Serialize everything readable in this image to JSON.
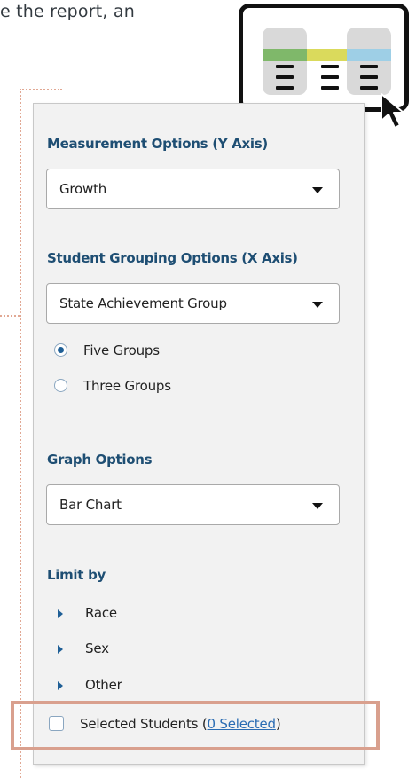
{
  "intro_fragment": "e the report, an",
  "panel": {
    "measurement": {
      "title": "Measurement Options (Y Axis)",
      "selected": "Growth"
    },
    "grouping": {
      "title": "Student Grouping Options (X Axis)",
      "selected": "State Achievement Group",
      "radio_options": [
        {
          "label": "Five Groups",
          "checked": true
        },
        {
          "label": "Three Groups",
          "checked": false
        }
      ]
    },
    "graph": {
      "title": "Graph Options",
      "selected": "Bar Chart"
    },
    "limit_by": {
      "title": "Limit by",
      "items": [
        "Race",
        "Sex",
        "Other"
      ]
    },
    "selected_students": {
      "label": "Selected Students",
      "paren_open": "(",
      "link_text": "0 Selected",
      "paren_close": ")",
      "checked": false
    }
  },
  "colors": {
    "section_title": "#1e4e73",
    "radio_selected": "#1f5f96",
    "link": "#2a6cb3",
    "highlight_border": "#d9a08e",
    "guide_dots": "#e1a894",
    "icon_band_green": "#7fb86a",
    "icon_band_yellow": "#dada5c",
    "icon_band_blue": "#9ecfe6"
  },
  "icons": {
    "callout": "column-chart-icon",
    "pointer": "cursor-arrow-icon",
    "dropdown": "caret-down-icon",
    "expand": "triangle-right-icon"
  }
}
